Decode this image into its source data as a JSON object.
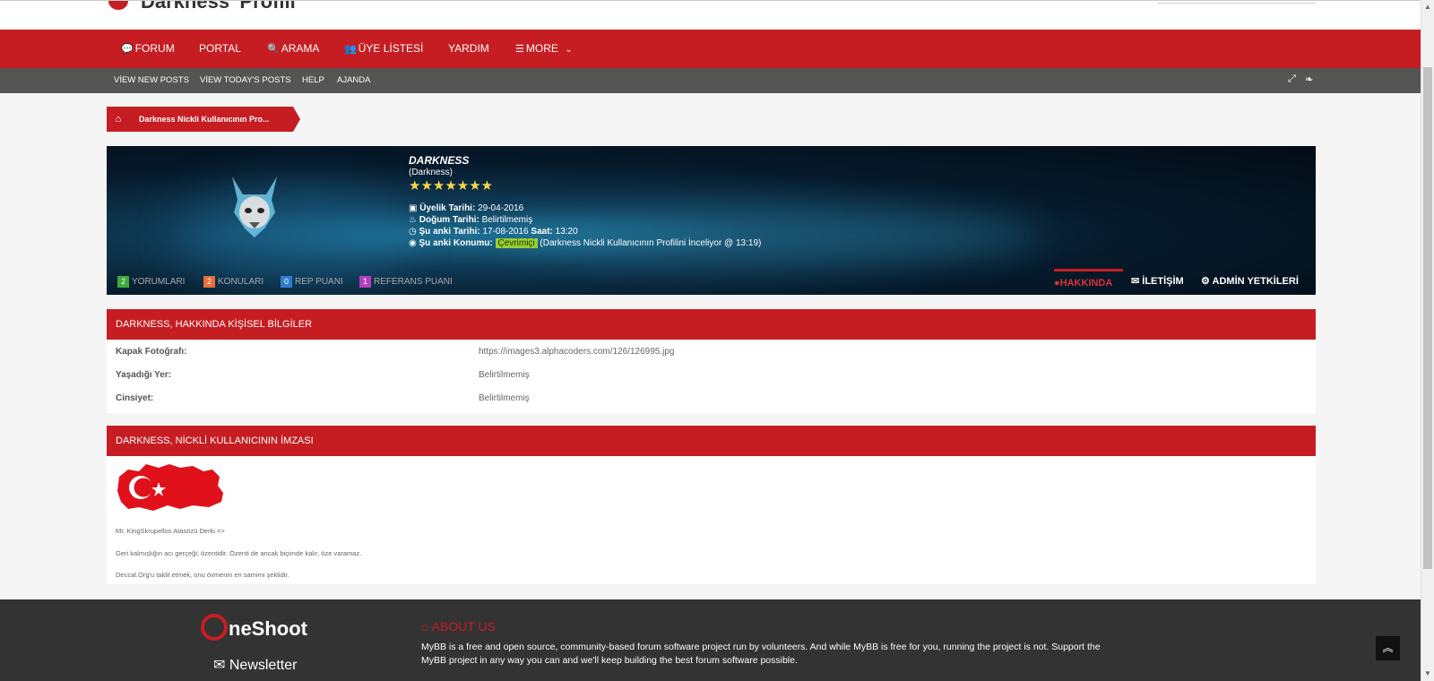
{
  "header": {
    "site_title": "Darkness' Profili"
  },
  "main_nav": [
    {
      "label": "FORUM",
      "icon": "comments-icon",
      "glyph": "💬"
    },
    {
      "label": "PORTAL",
      "icon": "",
      "glyph": ""
    },
    {
      "label": "ARAMA",
      "icon": "search-icon",
      "glyph": "🔍"
    },
    {
      "label": "ÜYE LİSTESİ",
      "icon": "users-icon",
      "glyph": "👥"
    },
    {
      "label": "YARDIM",
      "icon": "",
      "glyph": ""
    },
    {
      "label": "MORE",
      "icon": "menu-icon",
      "glyph": "☰",
      "caret": "⌄"
    }
  ],
  "sub_nav": [
    {
      "label": "VİEW NEW POSTS"
    },
    {
      "label": "VİEW TODAY'S POSTS"
    },
    {
      "label": "HELP"
    },
    {
      "label": "AJANDA"
    }
  ],
  "breadcrumb": {
    "home_icon": "home-icon",
    "current": "Darkness Nickli Kullanıcının Pro..."
  },
  "profile": {
    "username": "DARKNESS",
    "display_name": "(Darkness)",
    "stars": "★★★★★★★",
    "member_since_label": "Üyelik Tarihi:",
    "member_since": "29-04-2016",
    "birthday_label": "Doğum Tarihi:",
    "birthday": "Belirtilmemiş",
    "local_date_label": "Şu anki Tarihi:",
    "local_date": "17-08-2016",
    "local_time_label": "Saat:",
    "local_time": "13:20",
    "location_label": "Şu anki Konumu:",
    "status": "Çevrimiçi",
    "location": "(Darkness Nickli Kullanıcının Profilini İnceliyor @ 13:19)",
    "stats": [
      {
        "count": "2",
        "label": "YORUMLARI",
        "color": "#3bab3b"
      },
      {
        "count": "2",
        "label": "KONULARI",
        "color": "#e8703a"
      },
      {
        "count": "0",
        "label": "REP PUANI",
        "color": "#2f7bd1"
      },
      {
        "count": "1",
        "label": "REFERANS PUANI",
        "color": "#b53fc1"
      }
    ],
    "tabs": [
      {
        "label": "HAKKINDA",
        "icon": "user-icon",
        "glyph": "👤",
        "active": true
      },
      {
        "label": "İLETİŞİM",
        "icon": "envelope-icon",
        "glyph": "✉",
        "active": false
      },
      {
        "label": "ADMİN YETKİLERİ",
        "icon": "gear-icon",
        "glyph": "⚙",
        "active": false
      }
    ]
  },
  "about_panel": {
    "title": "DARKNESS, HAKKINDA KİŞİSEL BİLGİLER",
    "rows": [
      {
        "label": "Kapak Fotoğrafı:",
        "value": "https://images3.alphacoders.com/126/126995.jpg"
      },
      {
        "label": "Yaşadığı Yer:",
        "value": "Belirtilmemiş"
      },
      {
        "label": "Cinsiyet:",
        "value": "Belirtilmemiş"
      }
    ]
  },
  "signature_panel": {
    "title": "DARKNESS, NİCKLİ KULLANICININ İMZASI",
    "lines": [
      "Mr. KingSkrupellos Atasözü Derki =>",
      "Geri kalmışlığın acı gerçeği; özentidir. Özenti de ancak biçimde kalır, öze varamaz.",
      "Deccal.Org'u taklit etmek, onu övmenin en samimi şeklidir."
    ]
  },
  "footer": {
    "brand": "neShoot",
    "newsletter": "Newsletter",
    "about_title": "ABOUT US",
    "about_text": "MyBB is a free and open source, community-based forum software project run by volunteers. And while MyBB is free for you, running the project is not. Support the MyBB project in any way you can and we'll keep building the best forum software possible."
  },
  "colors": {
    "accent": "#c61d23",
    "subnav": "#555555",
    "footer": "#333333"
  }
}
